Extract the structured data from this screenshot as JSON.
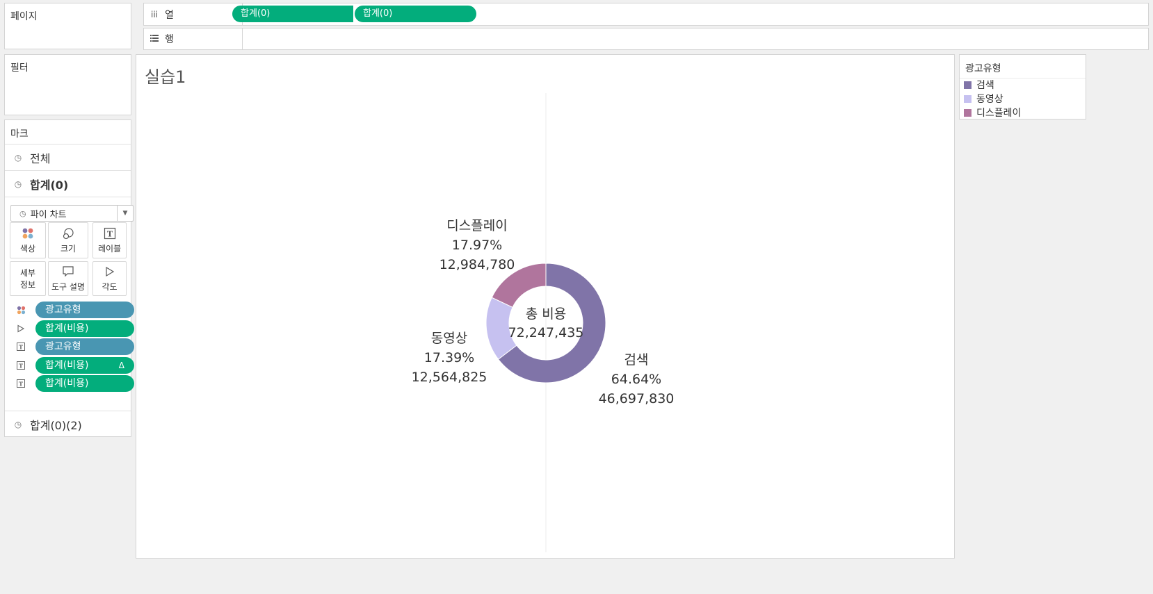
{
  "pages": {
    "title": "페이지"
  },
  "columns_shelf": {
    "icon": "iii",
    "label": "열",
    "pills": [
      "합계(0)",
      "합계(0)"
    ]
  },
  "rows_shelf": {
    "icon": "rows-icon",
    "label": "행"
  },
  "filters": {
    "title": "필터"
  },
  "marks": {
    "title": "마크",
    "layers": {
      "all": "전체",
      "sum0": "합계(0)",
      "sum0_2": "합계(0)(2)"
    },
    "mark_type": "파이 차트",
    "buttons": {
      "color": "색상",
      "size": "크기",
      "label": "레이블",
      "detail_line1": "세부",
      "detail_line2": "정보",
      "tooltip": "도구 설명",
      "angle": "각도"
    },
    "pills": [
      {
        "icon": "color-dots-icon",
        "text": "광고유형",
        "kind": "dimension"
      },
      {
        "icon": "angle-icon",
        "text": "합계(비용)",
        "kind": "measure"
      },
      {
        "icon": "label-icon",
        "text": "광고유형",
        "kind": "dimension"
      },
      {
        "icon": "label-icon",
        "text": "합계(비용)",
        "kind": "measure",
        "delta": "Δ"
      },
      {
        "icon": "label-icon",
        "text": "합계(비용)",
        "kind": "measure"
      }
    ]
  },
  "legend": {
    "title": "광고유형",
    "items": [
      {
        "label": "검색",
        "color": "#8074a8"
      },
      {
        "label": "동영상",
        "color": "#c6c1f0"
      },
      {
        "label": "디스플레이",
        "color": "#b0759d"
      }
    ]
  },
  "sheet": {
    "title": "실습1"
  },
  "chart_data": {
    "type": "pie",
    "center_label": "총 비용",
    "center_value": "72,247,435",
    "total": 72247435,
    "categories": [
      "검색",
      "동영상",
      "디스플레이"
    ],
    "values": [
      46697830,
      12564825,
      12984780
    ],
    "value_labels": [
      "46,697,830",
      "12,564,825",
      "12,984,780"
    ],
    "percent_labels": [
      "64.64%",
      "17.39%",
      "17.97%"
    ],
    "colors": [
      "#8074a8",
      "#c6c1f0",
      "#b0759d"
    ]
  }
}
